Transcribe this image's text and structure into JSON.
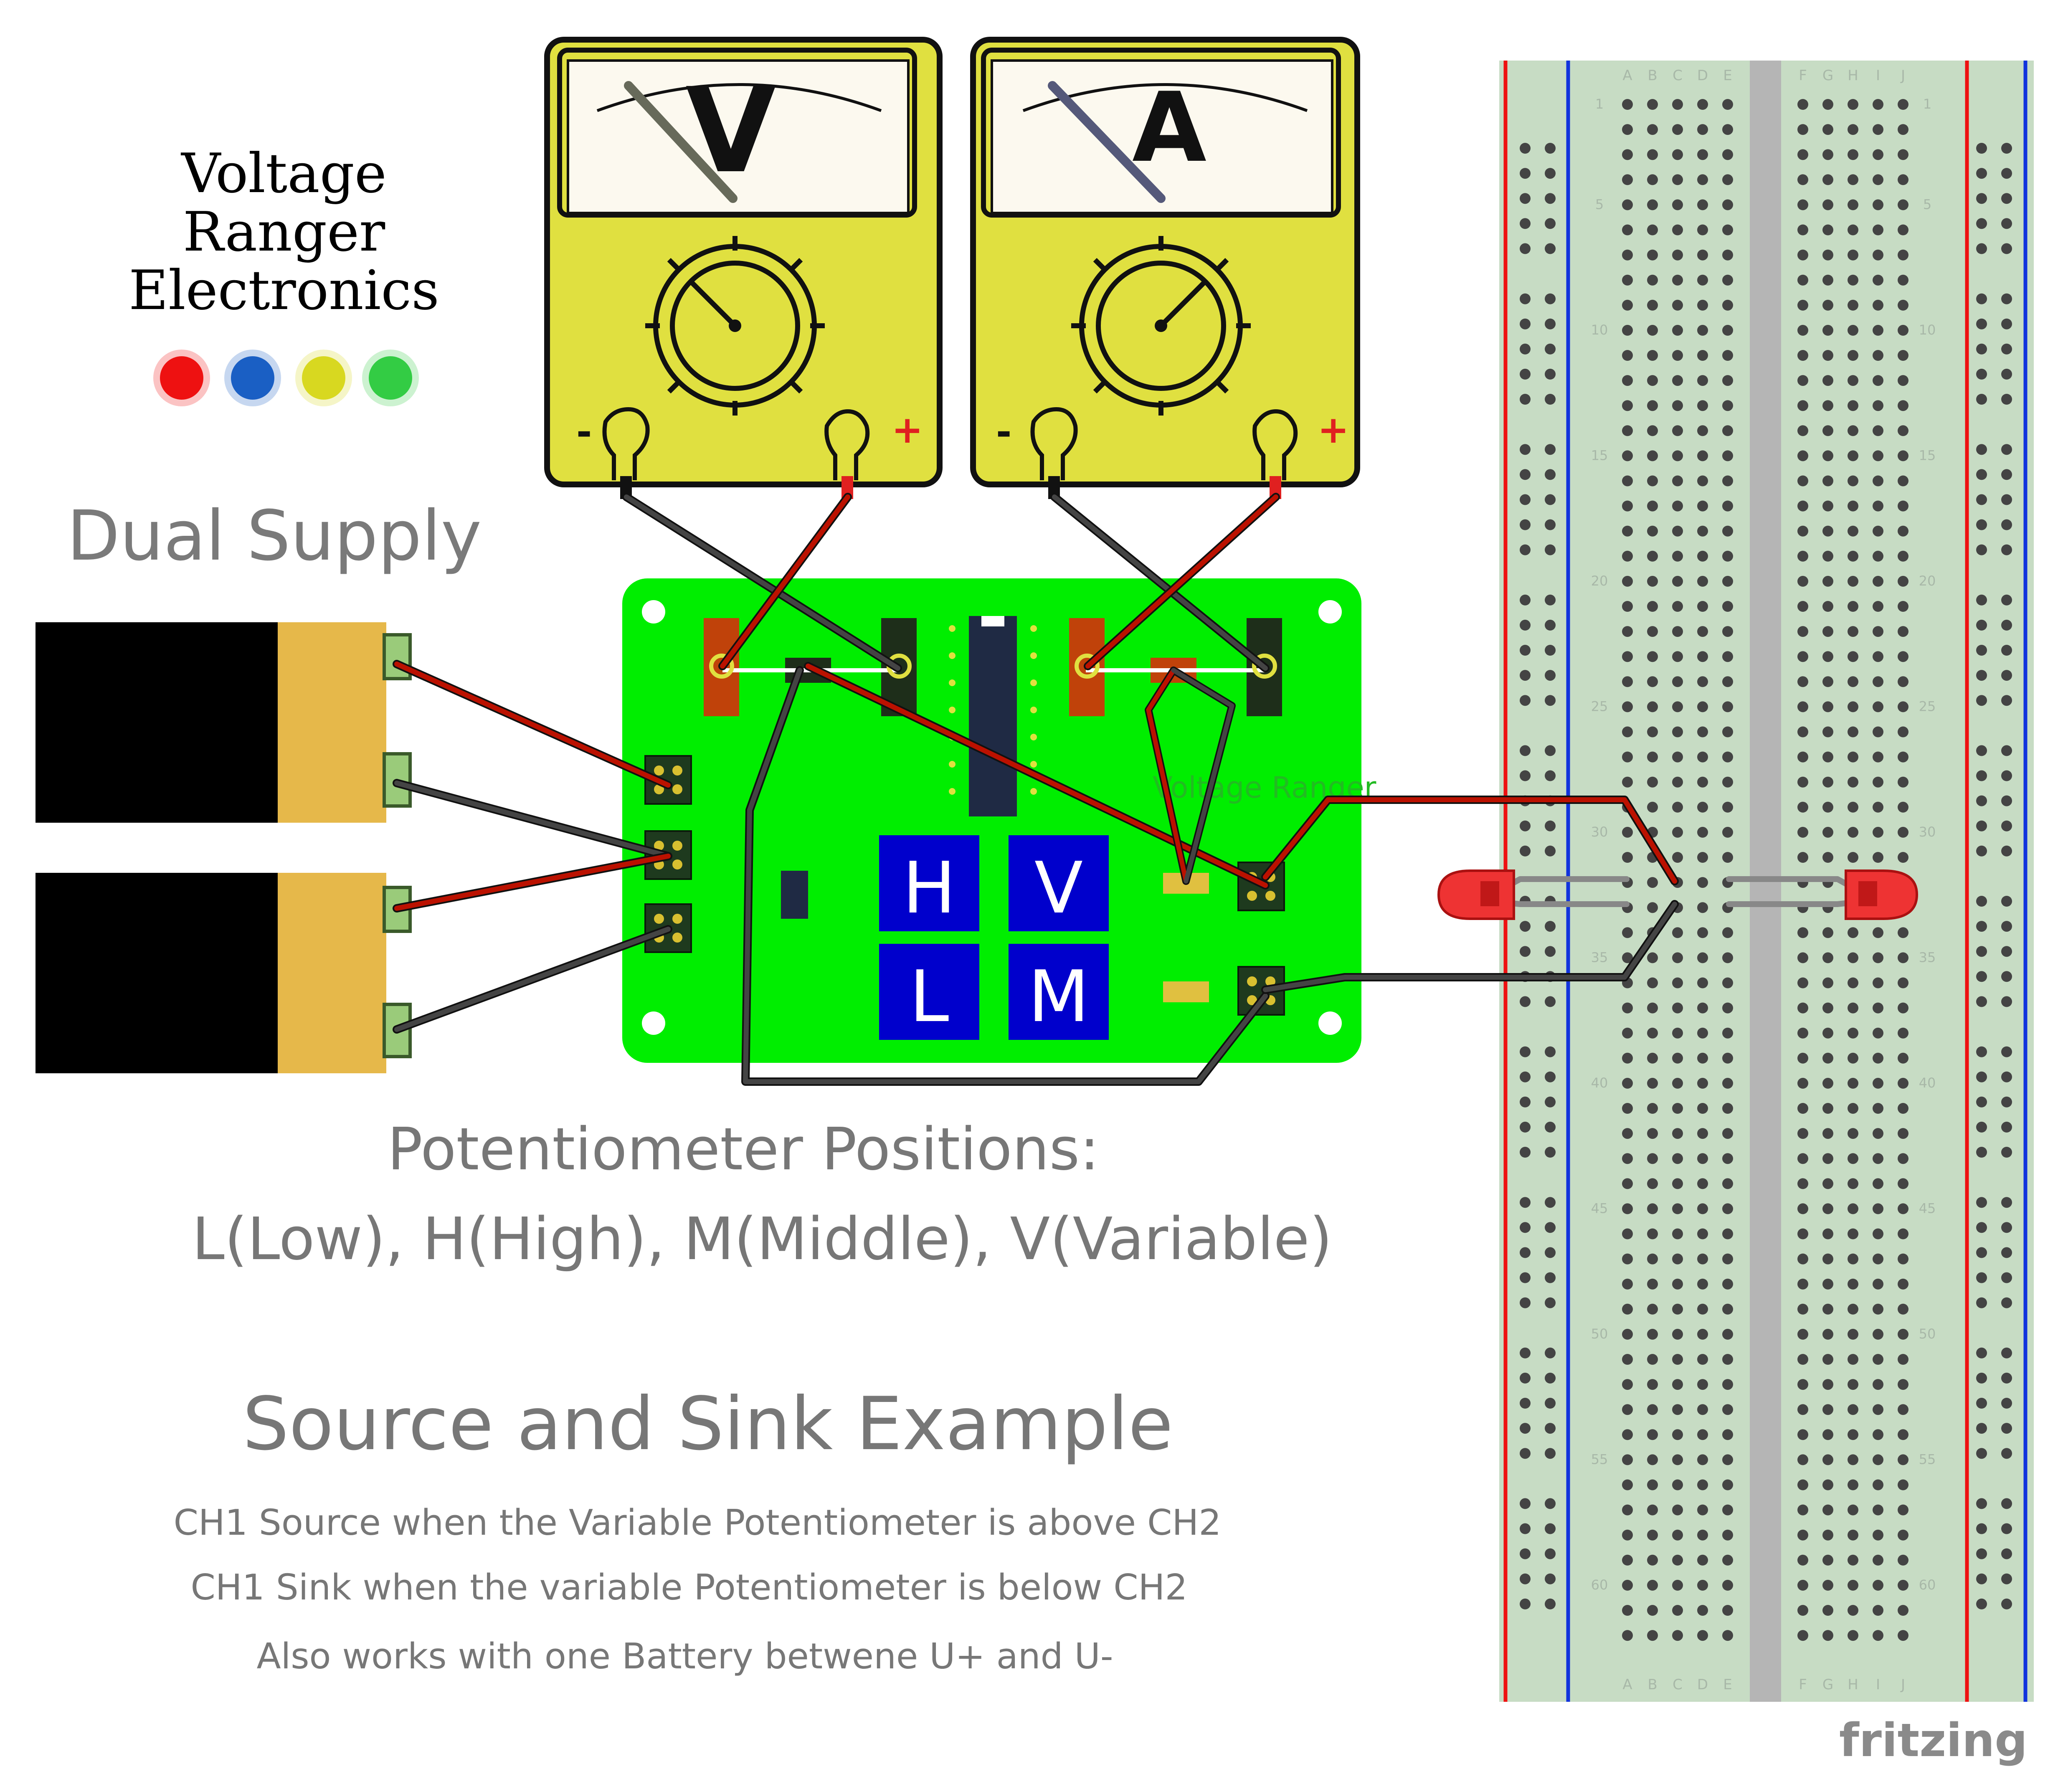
{
  "brand": {
    "title_lines": [
      "Voltage",
      "Ranger",
      "Electronics"
    ],
    "dot_colors": [
      "#ee1111",
      "#1a5fc4",
      "#d8d820",
      "#33cc44"
    ]
  },
  "supply_label": "Dual Supply",
  "meters": [
    {
      "symbol": "V",
      "minus": "-",
      "plus": "+",
      "needle_color": "#676a5a"
    },
    {
      "symbol": "A",
      "minus": "-",
      "plus": "+",
      "needle_color": "#55597a"
    }
  ],
  "board": {
    "silkscreen": "Voltage Ranger",
    "buttons": [
      "H",
      "V",
      "L",
      "M"
    ],
    "color": "#00ee00",
    "button_color": "#0000cc"
  },
  "pot_info": {
    "line1": "Potentiometer Positions:",
    "line2": "L(Low), H(High), M(Middle), V(Variable)"
  },
  "example": {
    "title": "Source and Sink Example",
    "lines": [
      "CH1 Source when the Variable Potentiometer is above CH2",
      "CH1 Sink when the variable Potentiometer is below CH2",
      "Also works with one Battery betwene U+ and U-"
    ]
  },
  "breadboard": {
    "columns_left": [
      "A",
      "B",
      "C",
      "D",
      "E"
    ],
    "columns_right": [
      "F",
      "G",
      "H",
      "I",
      "J"
    ],
    "row_numbers": [
      "1",
      "5",
      "10",
      "15",
      "20",
      "25",
      "30",
      "35",
      "40",
      "45",
      "50",
      "55",
      "60"
    ]
  },
  "colors": {
    "wire_red": "#bb1100",
    "wire_black": "#333333",
    "battery_body": "#000000",
    "battery_cap": "#e6b84a",
    "meter_body": "#e0e040",
    "breadboard": "#c7dcc4"
  },
  "footer": {
    "logo": "fritzing"
  }
}
